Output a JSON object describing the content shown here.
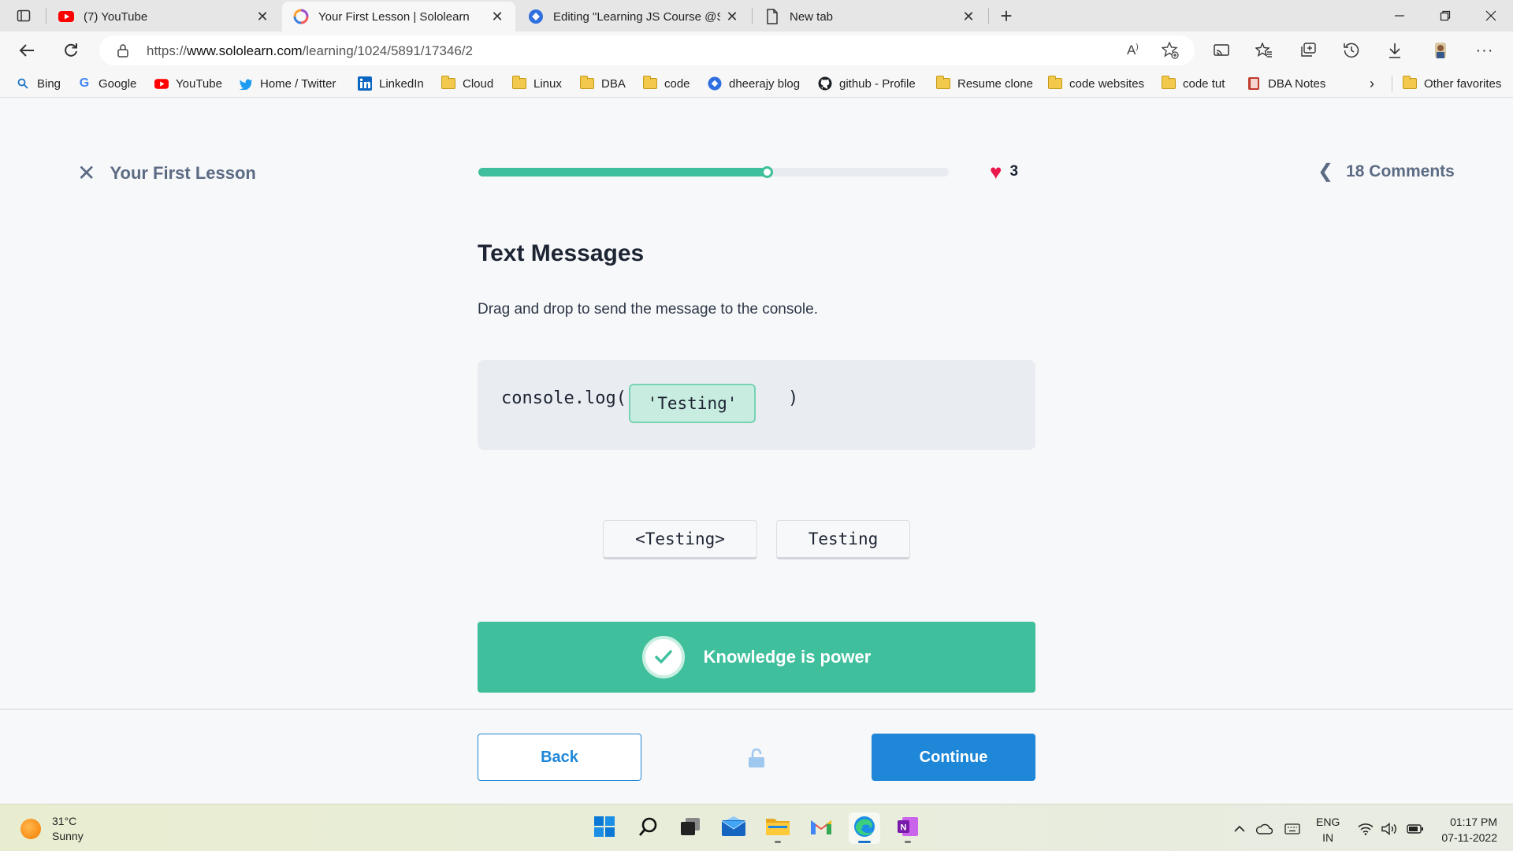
{
  "browser": {
    "tabs": [
      {
        "title": "(7) YouTube",
        "icon": "youtube-icon",
        "active": false
      },
      {
        "title": "Your First Lesson | Sololearn",
        "icon": "sololearn-icon",
        "active": true
      },
      {
        "title": "Editing \"Learning JS Course @Sc",
        "icon": "edit-site-icon",
        "active": false
      },
      {
        "title": "New tab",
        "icon": "page-icon",
        "active": false
      }
    ],
    "url_prefix": "https://",
    "url_domain": "www.sololearn.com",
    "url_path": "/learning/1024/5891/17346/2",
    "bookmarks": [
      {
        "label": "Bing",
        "icon": "search-icon"
      },
      {
        "label": "Google",
        "icon": "google-icon"
      },
      {
        "label": "YouTube",
        "icon": "youtube-icon"
      },
      {
        "label": "Home / Twitter",
        "icon": "twitter-icon"
      },
      {
        "label": "LinkedIn",
        "icon": "linkedin-icon"
      },
      {
        "label": "Cloud",
        "icon": "folder-icon"
      },
      {
        "label": "Linux",
        "icon": "folder-icon"
      },
      {
        "label": "DBA",
        "icon": "folder-icon"
      },
      {
        "label": "code",
        "icon": "folder-icon"
      },
      {
        "label": "dheerajy blog",
        "icon": "blog-icon"
      },
      {
        "label": "github - Profile",
        "icon": "github-icon"
      },
      {
        "label": "Resume clone",
        "icon": "folder-icon"
      },
      {
        "label": "code websites",
        "icon": "folder-icon"
      },
      {
        "label": "code tut",
        "icon": "folder-icon"
      },
      {
        "label": "DBA Notes",
        "icon": "notebook-icon"
      }
    ],
    "other_favorites": "Other favorites"
  },
  "lesson": {
    "close_label": "Your First Lesson",
    "progress_fraction": 0.615,
    "lives": "3",
    "comments_label": "18 Comments",
    "title": "Text Messages",
    "instruction": "Drag and drop to send the message to the console.",
    "code_open": "console.log(",
    "dropped_answer": "'Testing'",
    "code_close": ")",
    "options": [
      "<Testing>",
      "Testing"
    ],
    "feedback": "Knowledge is power",
    "back_label": "Back",
    "continue_label": "Continue"
  },
  "taskbar": {
    "temperature": "31°C",
    "weather": "Sunny",
    "lang_top": "ENG",
    "lang_bottom": "IN",
    "time": "01:17 PM",
    "date": "07-11-2022"
  },
  "colors": {
    "accent_green": "#3fbf9c",
    "accent_blue": "#1f87d8",
    "heart": "#e8194a"
  }
}
